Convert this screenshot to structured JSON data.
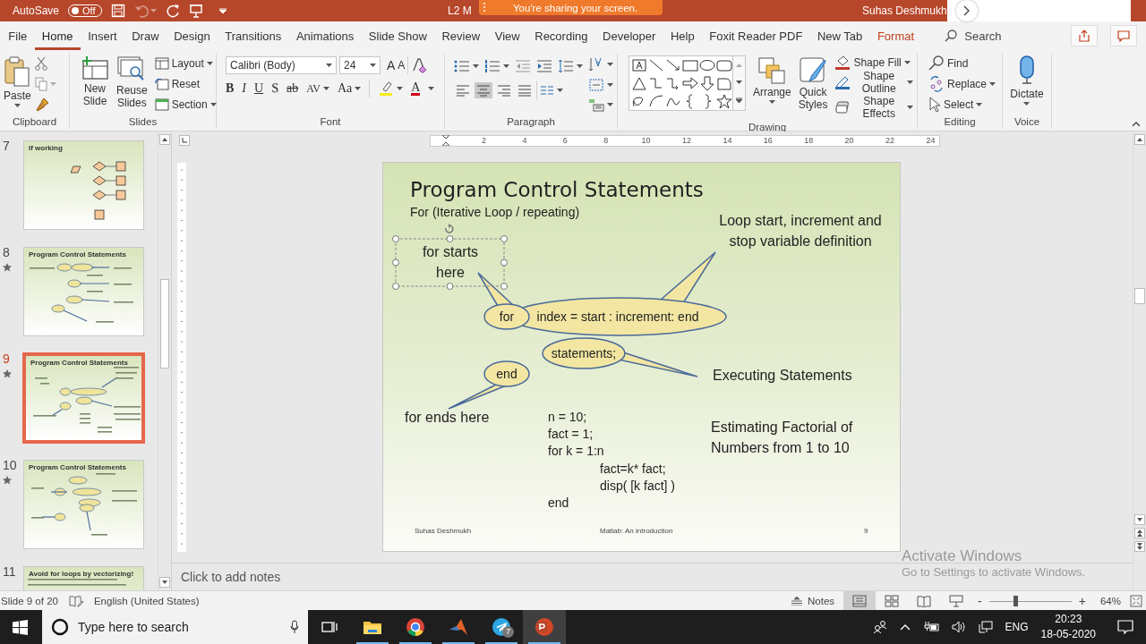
{
  "titlebar": {
    "autosave_label": "AutoSave",
    "autosave_on": false,
    "autosave_state": "Off",
    "undo_enabled": false,
    "document_title": "L2 M",
    "share_banner": "You're sharing your screen.",
    "user_name": "Suhas Deshmukh"
  },
  "tabs": [
    {
      "label": "File",
      "selected": false,
      "kind": "normal"
    },
    {
      "label": "Home",
      "selected": true,
      "kind": "normal"
    },
    {
      "label": "Insert",
      "selected": false,
      "kind": "normal"
    },
    {
      "label": "Draw",
      "selected": false,
      "kind": "normal"
    },
    {
      "label": "Design",
      "selected": false,
      "kind": "normal"
    },
    {
      "label": "Transitions",
      "selected": false,
      "kind": "normal"
    },
    {
      "label": "Animations",
      "selected": false,
      "kind": "normal"
    },
    {
      "label": "Slide Show",
      "selected": false,
      "kind": "normal"
    },
    {
      "label": "Review",
      "selected": false,
      "kind": "normal"
    },
    {
      "label": "View",
      "selected": false,
      "kind": "normal"
    },
    {
      "label": "Recording",
      "selected": false,
      "kind": "normal"
    },
    {
      "label": "Developer",
      "selected": false,
      "kind": "normal"
    },
    {
      "label": "Help",
      "selected": false,
      "kind": "normal"
    },
    {
      "label": "Foxit Reader PDF",
      "selected": false,
      "kind": "normal"
    },
    {
      "label": "New Tab",
      "selected": false,
      "kind": "normal"
    },
    {
      "label": "Format",
      "selected": false,
      "kind": "contextual"
    }
  ],
  "tell_me": {
    "placeholder": "Search"
  },
  "ribbon": {
    "clipboard": {
      "title": "Clipboard",
      "paste": "Paste"
    },
    "slides": {
      "title": "Slides",
      "new_slide": "New Slide",
      "reuse_slides": "Reuse Slides",
      "layout": "Layout",
      "reset": "Reset",
      "section": "Section"
    },
    "font": {
      "title": "Font",
      "font_name": "Calibri (Body)",
      "font_size": "24",
      "grow": "A",
      "shrink": "A",
      "styles": [
        "B",
        "I",
        "U",
        "S",
        "ab"
      ],
      "spacing": "AV",
      "change_case": "Aa",
      "font_color": "A"
    },
    "paragraph": {
      "title": "Paragraph",
      "alignment": [
        {
          "selected": false
        },
        {
          "selected": true
        },
        {
          "selected": false
        },
        {
          "selected": false
        }
      ]
    },
    "drawing": {
      "title": "Drawing",
      "arrange": "Arrange",
      "quick_styles": "Quick Styles",
      "shape_fill": "Shape Fill",
      "shape_outline": "Shape Outline",
      "shape_effects": "Shape Effects"
    },
    "editing": {
      "title": "Editing",
      "find": "Find",
      "replace": "Replace",
      "select": "Select"
    },
    "voice": {
      "title": "Voice",
      "dictate": "Dictate"
    }
  },
  "thumbnails": [
    {
      "number": "7",
      "title": "If working",
      "starred": false,
      "selected": false
    },
    {
      "number": "8",
      "title": "Program Control Statements",
      "starred": true,
      "selected": false
    },
    {
      "number": "9",
      "title": "Program Control Statements",
      "starred": true,
      "selected": true
    },
    {
      "number": "10",
      "title": "Program Control Statements",
      "starred": true,
      "selected": false
    },
    {
      "number": "11",
      "title": "Avoid for loops by vectorizing!",
      "starred": false,
      "selected": false
    }
  ],
  "ruler": {
    "labels": [
      "2",
      "4",
      "6",
      "8",
      "10",
      "12",
      "14",
      "16",
      "18",
      "20",
      "22",
      "24"
    ]
  },
  "slide": {
    "title": "Program Control Statements",
    "subtitle": "For (Iterative Loop / repeating)",
    "selected_text": "for starts here",
    "loop_note": "Loop start, increment and stop variable definition",
    "bubbles": [
      "for",
      "index  =  start : increment: end",
      "statements;",
      "end"
    ],
    "executing_note": "Executing Statements",
    "ends_note": "for ends here",
    "code": [
      {
        "text": "n = 10;"
      },
      {
        "text": "fact = 1;"
      },
      {
        "text": "for k = 1:n",
        "children": [
          {
            "text": "fact=k* fact;"
          },
          {
            "text": "disp( [k fact] )"
          }
        ]
      },
      {
        "text": "end"
      }
    ],
    "factorial_note": "Estimating Factorial of Numbers from 1 to 10",
    "footer_author": "Suhas Deshmukh",
    "footer_title": "Matlab: An introduction",
    "footer_number": "9"
  },
  "notes": {
    "placeholder": "Click to add notes"
  },
  "status_bar": {
    "slide_position": "Slide 9 of 20",
    "language": "English (United States)",
    "notes_button": "Notes",
    "views": [
      {
        "selected": true
      },
      {
        "selected": false
      },
      {
        "selected": false
      },
      {
        "selected": false
      }
    ],
    "zoom_minus": "-",
    "zoom": {
      "level": 0.32
    },
    "zoom_plus": "+",
    "zoom_percent": "64%"
  },
  "activation_notice": {
    "title": "Activate Windows",
    "message": "Go to Settings to activate Windows."
  },
  "taskbar": {
    "search": {
      "placeholder": "Type here to search"
    },
    "apps": [
      {
        "active": false
      },
      {
        "active": false
      },
      {
        "active": false
      },
      {
        "active": false,
        "badge": "7"
      },
      {
        "active": true
      }
    ],
    "language": "ENG",
    "time": "20:23",
    "date": "18-05-2020"
  }
}
